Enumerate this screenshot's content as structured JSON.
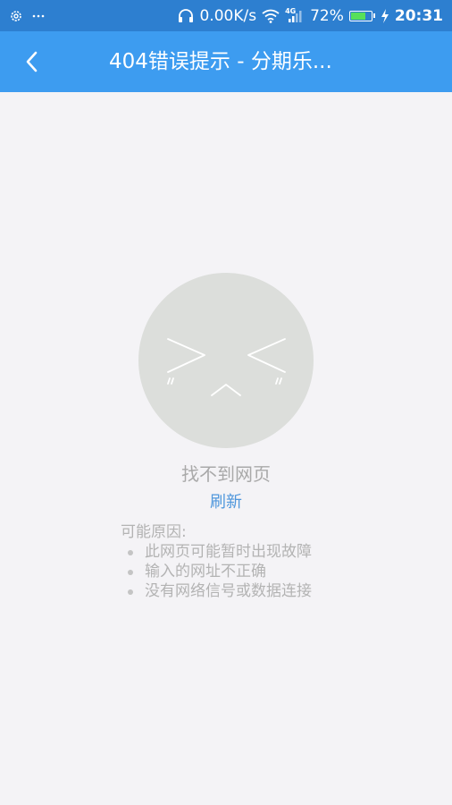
{
  "status_bar": {
    "speed": "0.00K/s",
    "network": "4G",
    "battery_percent": "72%",
    "battery_level": 0.72,
    "time": "20:31"
  },
  "app_bar": {
    "title": "404错误提示 - 分期乐..."
  },
  "error": {
    "title": "找不到网页",
    "refresh": "刷新",
    "reasons_heading": "可能原因:",
    "reasons": [
      "此网页可能暂时出现故障",
      "输入的网址不正确",
      "没有网络信号或数据连接"
    ]
  },
  "colors": {
    "status_bar_bg": "#2d7fd0",
    "app_bar_bg": "#3d9cf0",
    "page_bg": "#f4f3f6",
    "face_fill": "#dcdedb",
    "link": "#4f97dc",
    "muted_text": "#a9a9a9",
    "battery_fill": "#57e05a"
  }
}
